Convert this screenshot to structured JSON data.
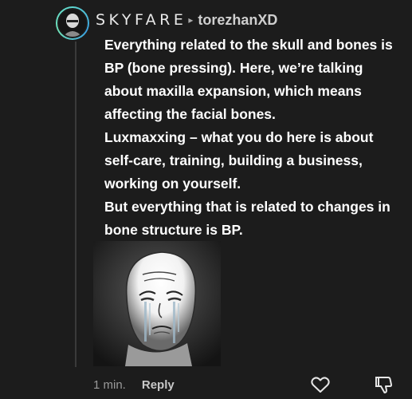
{
  "comment": {
    "sender": "SKYFARE",
    "reply_arrow": "▸",
    "recipient": "torezhanXD",
    "paragraphs": [
      "Everything related to the skull and bones is BP (bone pressing). Here, we’re talking about maxilla expansion, which means affecting the facial bones.",
      "Luxmaxxing – what you do here is about self-care, training, building a business, working on yourself.",
      "But everything that is related to changes in bone structure is BP."
    ],
    "attachment_icon": "crying-wojak-meme",
    "time": "1 min.",
    "reply_label": "Reply",
    "like_icon": "heart-outline-icon",
    "dislike_icon": "thumbs-down-icon"
  },
  "colors": {
    "background": "#1c1c1c",
    "text": "#ffffff",
    "muted": "#9a9a9a",
    "avatar_ring": "#5ed6d0"
  }
}
